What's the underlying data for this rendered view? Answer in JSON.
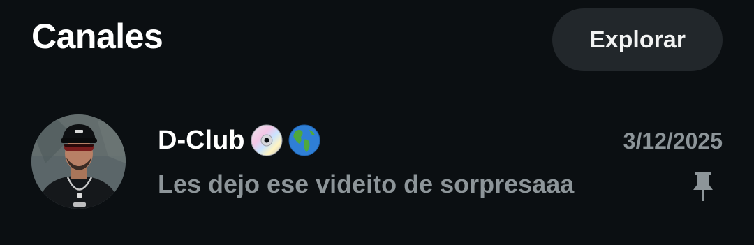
{
  "header": {
    "title": "Canales",
    "explore_label": "Explorar"
  },
  "channels": [
    {
      "name": "D-Club",
      "emojis": [
        "cd-icon",
        "globe-icon"
      ],
      "date": "3/12/2025",
      "preview": "Les dejo ese videito de sorpresaaa",
      "pinned": true,
      "pin_icon": "pin-icon"
    }
  ],
  "colors": {
    "background": "#0b0f12",
    "button_bg": "#22272b",
    "primary_text": "#ffffff",
    "secondary_text": "#8d9599"
  }
}
